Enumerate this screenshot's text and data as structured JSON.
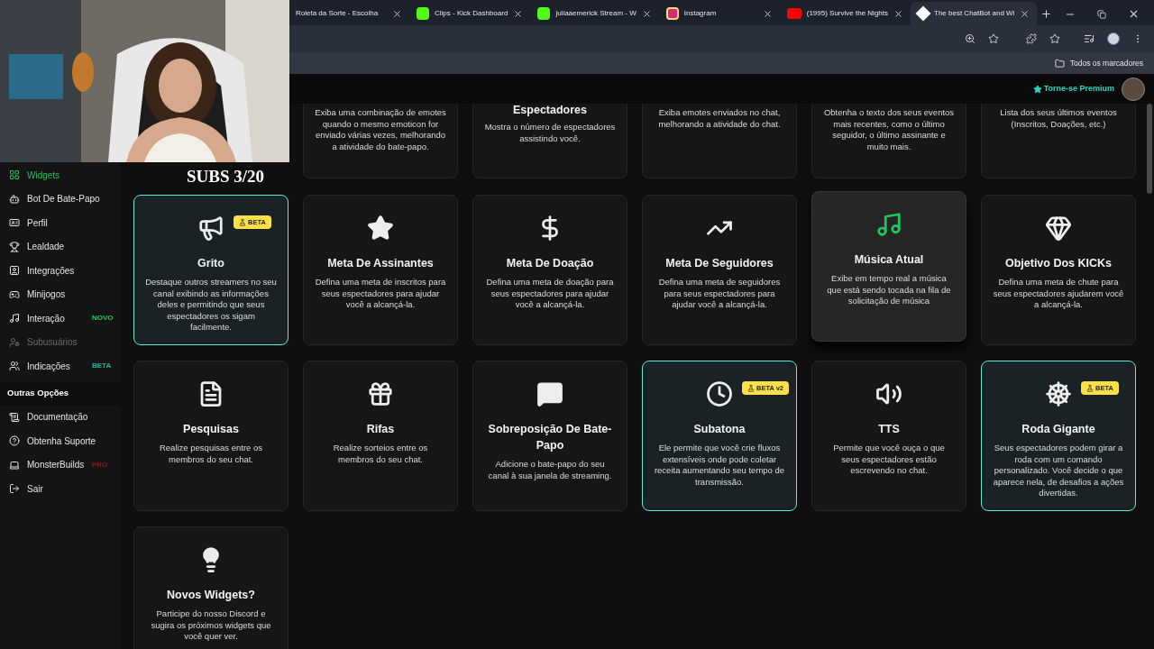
{
  "browser": {
    "tabs": [
      {
        "title": "Roleta da Sorte - Escolha",
        "selected": false
      },
      {
        "title": "Clips - Kick Dashboard",
        "selected": false
      },
      {
        "title": "juliaaemerick Stream - W",
        "selected": false
      },
      {
        "title": "Instagram",
        "selected": false
      },
      {
        "title": "(1995) Survive the Nights",
        "selected": false
      },
      {
        "title": "The best ChatBot and Wi",
        "selected": true
      }
    ],
    "bookmarks": "Todos os marcadores"
  },
  "webcam": {
    "kind": "picture",
    "overlay_text": "SUBS 3/20"
  },
  "header": {
    "premium": "Torne-se Premium"
  },
  "sidebar": {
    "items": [
      {
        "label": "Widgets",
        "selected": true,
        "disabled": false
      },
      {
        "label": "Bot De Bate-Papo",
        "selected": false,
        "disabled": false
      },
      {
        "label": "Perfil",
        "selected": false,
        "disabled": false
      },
      {
        "label": "Lealdade",
        "selected": false,
        "disabled": false
      },
      {
        "label": "Integrações",
        "selected": false,
        "disabled": false
      },
      {
        "label": "Minijogos",
        "selected": false,
        "disabled": false
      },
      {
        "label": "Interação",
        "selected": false,
        "disabled": false,
        "badge": "NOVO",
        "color": "#22c55e"
      },
      {
        "label": "Subusuários",
        "selected": false,
        "disabled": true
      },
      {
        "label": "Indicações",
        "selected": false,
        "disabled": false,
        "badge": "BETA",
        "color": "#14b8a6"
      }
    ],
    "section": "Outras Opções",
    "other_items": [
      {
        "label": "Documentação",
        "selected": false,
        "disabled": false
      },
      {
        "label": "Obtenha Suporte",
        "selected": false,
        "disabled": false
      },
      {
        "label": "MonsterBuilds",
        "selected": false,
        "disabled": false,
        "badge": "PRO",
        "color": "#7f1d1d"
      },
      {
        "label": "Sair",
        "selected": false,
        "disabled": false
      }
    ]
  },
  "widgets": {
    "partial_row": [
      {
        "description": "Exiba uma combinação de emotes quando o mesmo emoticon for enviado várias vezes, melhorando a atividade do bate-papo."
      },
      {
        "title": "Espectadores",
        "description": "Mostra o número de espectadores assistindo você."
      },
      {
        "description": "Exiba emotes enviados no chat, melhorando a atividade do chat."
      },
      {
        "description": "Obtenha o texto dos seus eventos mais recentes, como o último seguidor, o último assinante e muito mais."
      },
      {
        "description": "Lista dos seus últimos eventos (Inscritos, Doações, etc.)"
      }
    ],
    "cards": [
      {
        "title": "Grito",
        "description": "Destaque outros streamers no seu canal exibindo as informações deles e permitindo que seus espectadores os sigam facilmente.",
        "highlighted": true,
        "hovered": false,
        "badge": "BETA"
      },
      {
        "title": "Meta De Assinantes",
        "description": "Defina uma meta de inscritos para seus espectadores para ajudar você a alcançá-la.",
        "highlighted": false,
        "hovered": false
      },
      {
        "title": "Meta De Doação",
        "description": "Defina uma meta de doação para seus espectadores para ajudar você a alcançá-la.",
        "highlighted": false,
        "hovered": false
      },
      {
        "title": "Meta De Seguidores",
        "description": "Defina uma meta de seguidores para seus espectadores para ajudar você a alcançá-la.",
        "highlighted": false,
        "hovered": false
      },
      {
        "title": "Música Atual",
        "description": "Exibe em tempo real a música que está sendo tocada na fila de solicitação de música",
        "highlighted": false,
        "hovered": true,
        "color": "#22c55e"
      },
      {
        "title": "Objetivo Dos KICKs",
        "description": "Defina uma meta de chute para seus espectadores ajudarem você a alcançá-la.",
        "highlighted": false,
        "hovered": false
      },
      {
        "title": "Pesquisas",
        "description": "Realize pesquisas entre os membros do seu chat.",
        "highlighted": false,
        "hovered": false
      },
      {
        "title": "Rifas",
        "description": "Realize sorteios entre os membros do seu chat.",
        "highlighted": false,
        "hovered": false
      },
      {
        "title": "Sobreposição De Bate-Papo",
        "description": "Adicione o bate-papo do seu canal à sua janela de streaming.",
        "highlighted": false,
        "hovered": false
      },
      {
        "title": "Subatona",
        "description": "Ele permite que você crie fluxos extensíveis onde pode coletar receita aumentando seu tempo de transmissão.",
        "highlighted": true,
        "hovered": false,
        "badge": "BETA v2"
      },
      {
        "title": "TTS",
        "description": "Permite que você ouça o que seus espectadores estão escrevendo no chat.",
        "highlighted": false,
        "hovered": false
      },
      {
        "title": "Roda Gigante",
        "description": "Seus espectadores podem girar a roda com um comando personalizado. Você decide o que aparece nela, de desafios a ações divertidas.",
        "highlighted": true,
        "hovered": false,
        "badge": "BETA"
      },
      {
        "title": "Novos Widgets?",
        "description": "Participe do nosso Discord e sugira os próximos widgets que você quer ver.",
        "highlighted": false,
        "hovered": false
      }
    ]
  }
}
